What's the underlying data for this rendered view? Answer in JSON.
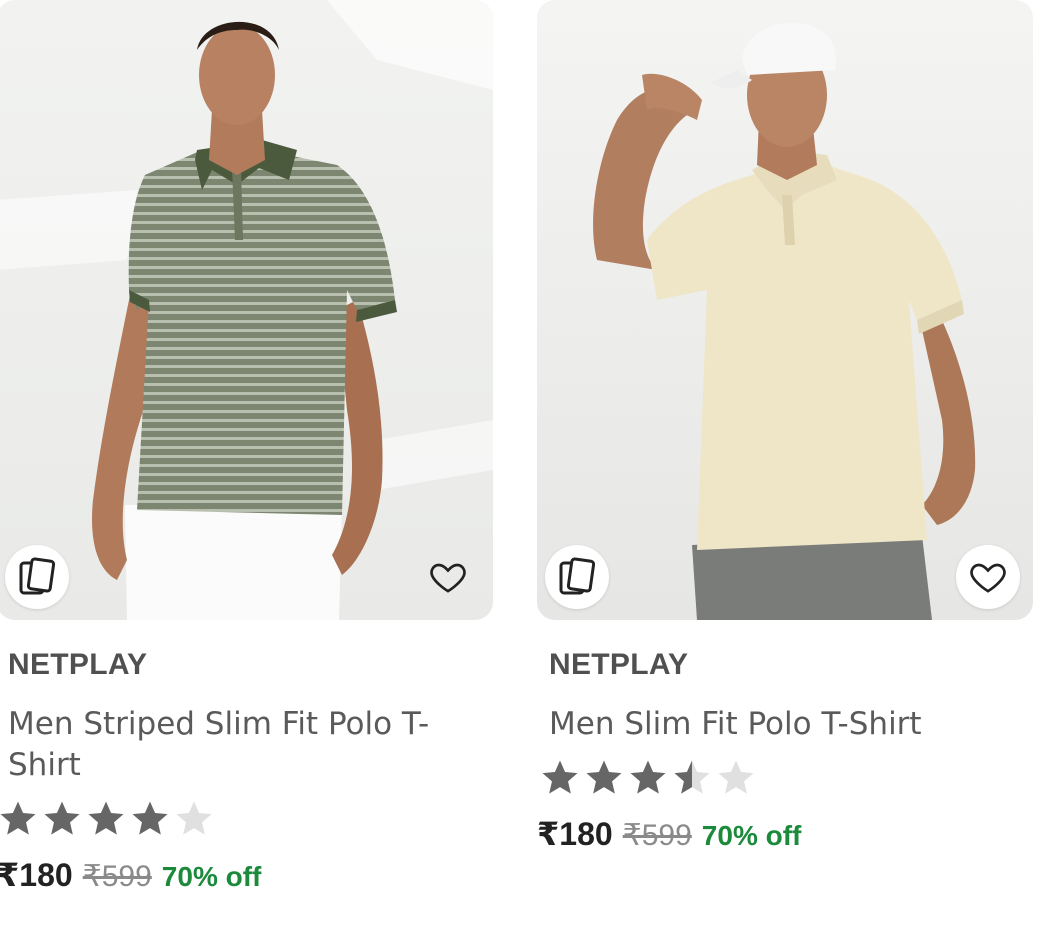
{
  "colors": {
    "discount": "#1b8a3b",
    "star_filled": "#666666",
    "star_empty": "#e0e0e0",
    "price": "#222222",
    "mrp": "#8a8a8a"
  },
  "products": [
    {
      "brand": "NETPLAY",
      "title": "Men Striped Slim Fit Polo T-Shirt",
      "rating": 4,
      "price": "₹180",
      "mrp": "₹599",
      "discount": "70% off",
      "image_alt": "Man wearing olive striped polo t-shirt",
      "icons": [
        "similar-products-icon",
        "heart-icon"
      ]
    },
    {
      "brand": "NETPLAY",
      "title": "Men Slim Fit Polo T-Shirt",
      "rating": 3.5,
      "price": "₹180",
      "mrp": "₹599",
      "discount": "70% off",
      "image_alt": "Man in white cap wearing beige polo t-shirt",
      "icons": [
        "similar-products-icon",
        "heart-icon"
      ]
    }
  ]
}
